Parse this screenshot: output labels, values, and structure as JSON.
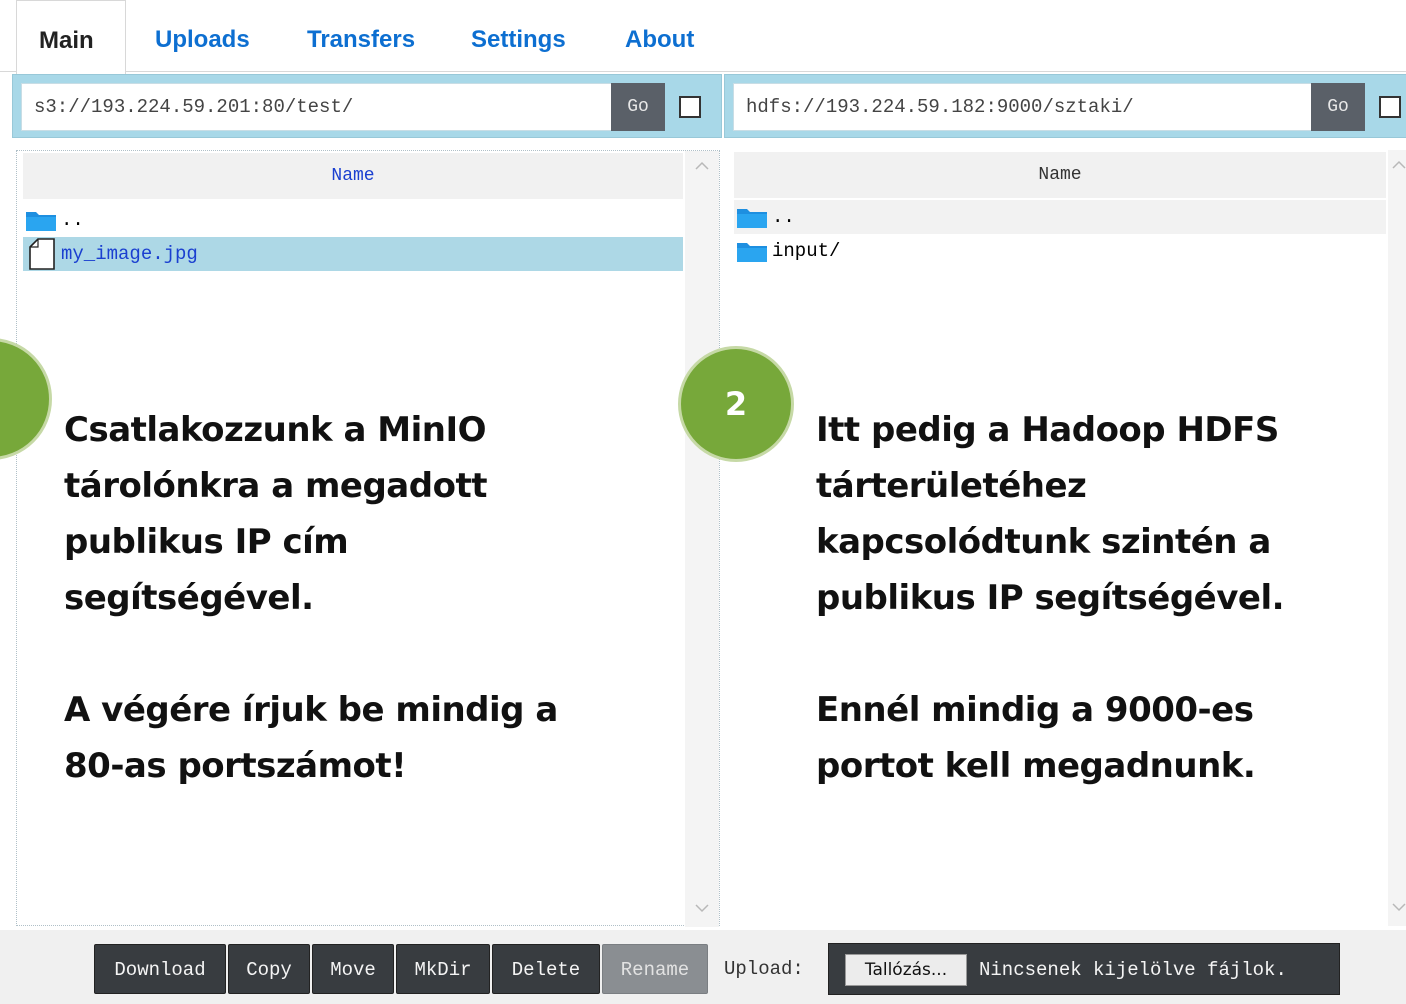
{
  "tabs": [
    {
      "label": "Main",
      "active": true
    },
    {
      "label": "Uploads",
      "active": false
    },
    {
      "label": "Transfers",
      "active": false
    },
    {
      "label": "Settings",
      "active": false
    },
    {
      "label": "About",
      "active": false
    }
  ],
  "left_pane": {
    "url": "s3://193.224.59.201:80/test/",
    "go_label": "Go",
    "column_header": "Name",
    "rows": [
      {
        "name": "..",
        "type": "folder",
        "selected": false
      },
      {
        "name": "my_image.jpg",
        "type": "file",
        "selected": true
      }
    ]
  },
  "right_pane": {
    "url": "hdfs://193.224.59.182:9000/sztaki/",
    "go_label": "Go",
    "column_header": "Name",
    "rows": [
      {
        "name": "..",
        "type": "folder",
        "selected": false
      },
      {
        "name": "input/",
        "type": "folder",
        "selected": false
      }
    ]
  },
  "annotations": {
    "left": {
      "lines": [
        "Csatlakozzunk a MinIO",
        "tárolónkra a megadott",
        "publikus IP cím",
        "segítségével."
      ],
      "lines2": [
        "A végére írjuk be mindig a",
        "80-as portszámot!"
      ]
    },
    "right": {
      "badge": "2",
      "lines": [
        "Itt pedig a Hadoop HDFS",
        "tárterületéhez",
        "kapcsolódtunk szintén a",
        "publikus IP segítségével."
      ],
      "lines2": [
        "Ennél mindig a 9000-es",
        "portot kell megadnunk."
      ]
    }
  },
  "toolbar": {
    "download": "Download",
    "copy": "Copy",
    "move": "Move",
    "mkdir": "MkDir",
    "delete": "Delete",
    "rename": "Rename",
    "upload_label": "Upload:",
    "browse": "Tallózás...",
    "no_file": "Nincsenek kijelölve fájlok."
  },
  "colors": {
    "tab_link": "#0d6fd1",
    "bar_bg": "#a8d8e8",
    "selected_row": "#add8e6",
    "badge_green": "#77a83a",
    "button_dark": "#383c40"
  }
}
